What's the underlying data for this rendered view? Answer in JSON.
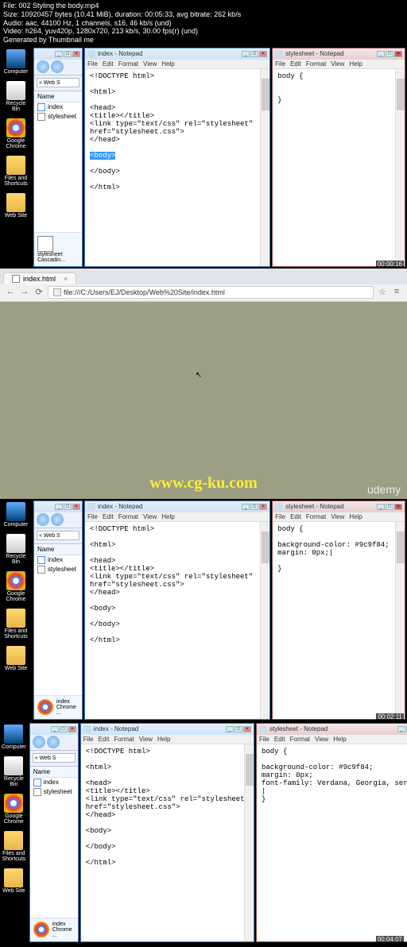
{
  "metadata": {
    "file": "File: 002 Styling the body.mp4",
    "size": "Size: 10920457 bytes (10.41 MiB), duration: 00:05:33, avg bitrate: 262 kb/s",
    "audio": "Audio: aac, 44100 Hz, 1 channels, s16, 46 kb/s (und)",
    "video": "Video: h264, yuv420p, 1280x720, 213 kb/s, 30.00 fps(r) (und)",
    "gen": "Generated by Thumbnail me"
  },
  "desktop": {
    "computer": "Computer",
    "recycle": "Recycle Bin",
    "chrome": "Google Chrome",
    "files": "Files and Shortcuts",
    "website": "Web Site"
  },
  "explorer": {
    "nameCol": "Name",
    "index": "index",
    "stylesheet": "stylesheet",
    "addr": "« Web S",
    "detail1": {
      "name": "stylesheet",
      "type": "Cascadin..."
    },
    "detail2": {
      "name": "index",
      "type": "Chrome ..."
    }
  },
  "notepad1": {
    "title": "index - Notepad",
    "menu": {
      "file": "File",
      "edit": "Edit",
      "format": "Format",
      "view": "View",
      "help": "Help"
    },
    "content_pre": "<!DOCTYPE html>\n\n<html>\n\n<head>\n<title></title>\n<link type=\"text/css\" rel=\"stylesheet\"\nhref=\"stylesheet.css\">\n</head>\n\n",
    "sel": "<body>",
    "content_post": "\n\n</body>\n\n</html>"
  },
  "notepad2": {
    "title": "stylesheet - Notepad",
    "menu": {
      "file": "File",
      "edit": "Edit",
      "format": "Format",
      "view": "View",
      "help": "Help"
    },
    "content": "body {\n\n\n}"
  },
  "browser": {
    "tab": "index.html",
    "url": "file:///C:/Users/EJ/Desktop/Web%20Site/index.html",
    "watermark": "www.cg-ku.com",
    "udemy": "udemy"
  },
  "notepad3": {
    "content": "<!DOCTYPE html>\n\n<html>\n\n<head>\n<title></title>\n<link type=\"text/css\" rel=\"stylesheet\"\nhref=\"stylesheet.css\">\n</head>\n\n<body>\n\n</body>\n\n</html>"
  },
  "notepad4": {
    "content": "body {\n\nbackground-color: #9c9f84;\nmargin: 0px;|\n\n}"
  },
  "notepad5": {
    "content": "<!DOCTYPE html>\n\n<html>\n\n<head>\n<title></title>\n<link type=\"text/css\" rel=\"stylesheet\"\nhref=\"stylesheet.css\">\n</head>\n\n<body>\n\n</body>\n\n</html>"
  },
  "notepad6": {
    "content": "body {\n\nbackground-color: #9c9f84;\nmargin: 0px;\nfont-family: Verdana, Georgia, serif;\n|\n}"
  },
  "ts1": "00:00:16",
  "ts2": "00:02:11",
  "ts3": "00:04:07"
}
